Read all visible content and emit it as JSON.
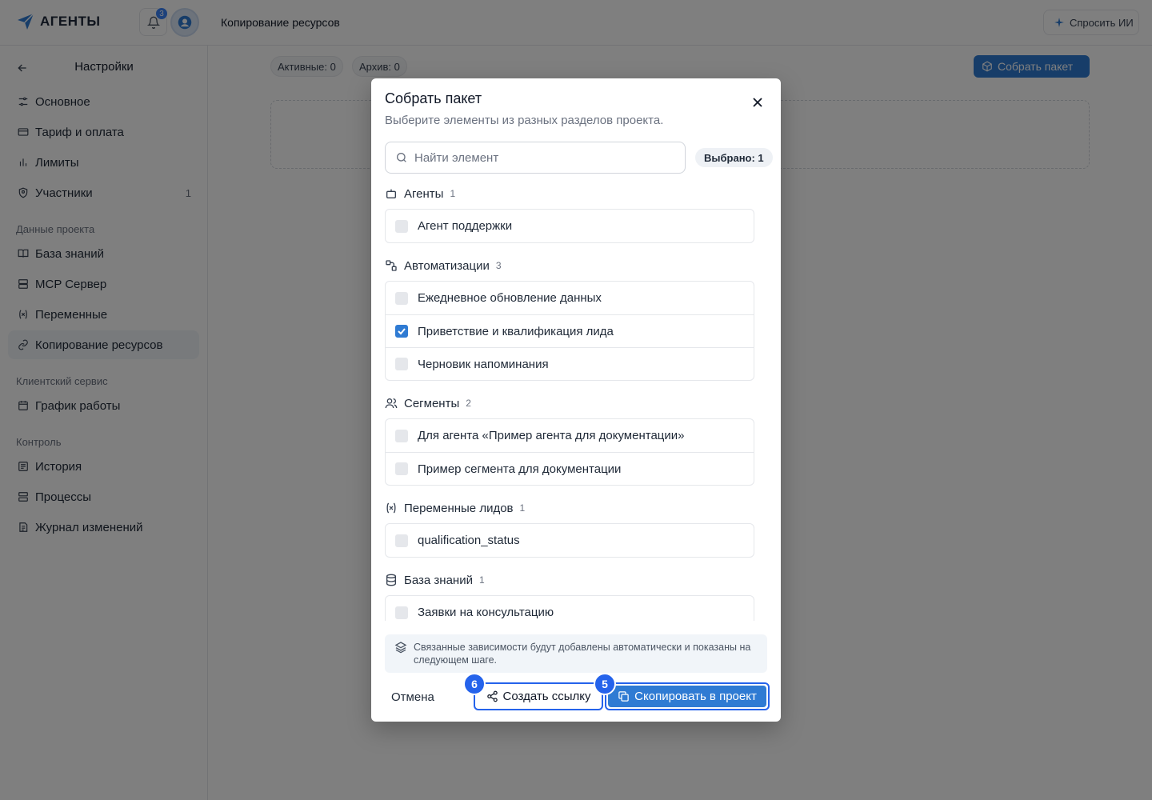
{
  "topbar": {
    "logo_text": "АГЕНТЫ",
    "notifications_count": "3",
    "page_title": "Копирование ресурсов",
    "ask_ai_label": "Спросить ИИ"
  },
  "sidebar": {
    "title": "Настройки",
    "items": [
      {
        "label": "Основное",
        "icon": "sliders-icon"
      },
      {
        "label": "Тариф и оплата",
        "icon": "card-icon"
      },
      {
        "label": "Лимиты",
        "icon": "bar-chart-icon"
      },
      {
        "label": "Участники",
        "icon": "shield-user-icon",
        "count": "1"
      }
    ],
    "sections": [
      {
        "title": "Данные проекта",
        "items": [
          {
            "label": "База знаний",
            "icon": "book-icon"
          },
          {
            "label": "MCP Сервер",
            "icon": "server-icon"
          },
          {
            "label": "Переменные",
            "icon": "variable-icon"
          },
          {
            "label": "Копирование ресурсов",
            "icon": "link-icon",
            "active": true
          }
        ]
      },
      {
        "title": "Клиентский сервис",
        "items": [
          {
            "label": "График работы",
            "icon": "calendar-icon"
          }
        ]
      },
      {
        "title": "Контроль",
        "items": [
          {
            "label": "История",
            "icon": "history-icon"
          },
          {
            "label": "Процессы",
            "icon": "list-icon"
          },
          {
            "label": "Журнал изменений",
            "icon": "changelog-icon"
          }
        ]
      }
    ]
  },
  "main": {
    "active_pill": "Активные: 0",
    "archive_pill": "Архив: 0",
    "collect_button": "Собрать пакет"
  },
  "modal": {
    "title": "Собрать пакет",
    "subtitle": "Выберите элементы из разных разделов проекта.",
    "search_placeholder": "Найти элемент",
    "selected_badge": "Выбрано: 1",
    "categories": [
      {
        "name": "Агенты",
        "count": "1",
        "icon": "bot-icon",
        "items": [
          {
            "label": "Агент поддержки",
            "checked": false
          }
        ]
      },
      {
        "name": "Автоматизации",
        "count": "3",
        "icon": "workflow-icon",
        "items": [
          {
            "label": "Ежедневное обновление данных",
            "checked": false
          },
          {
            "label": "Приветствие и квалификация лида",
            "checked": true
          },
          {
            "label": "Черновик напоминания",
            "checked": false
          }
        ]
      },
      {
        "name": "Сегменты",
        "count": "2",
        "icon": "users-icon",
        "items": [
          {
            "label": "Для агента «Пример агента для документации»",
            "checked": false
          },
          {
            "label": "Пример сегмента для документации",
            "checked": false
          }
        ]
      },
      {
        "name": "Переменные лидов",
        "count": "1",
        "icon": "variable-icon",
        "items": [
          {
            "label": "qualification_status",
            "checked": false
          }
        ]
      },
      {
        "name": "База знаний",
        "count": "1",
        "icon": "database-icon",
        "items": [
          {
            "label": "Заявки на консультацию",
            "checked": false
          }
        ]
      }
    ],
    "info_text": "Связанные зависимости будут добавлены автоматически и показаны на следующем шаге.",
    "cancel_label": "Отмена",
    "create_link_label": "Создать ссылку",
    "copy_label": "Скопировать в проект",
    "step_create_link": "6",
    "step_copy": "5"
  },
  "colors": {
    "accent": "#2f7bd3",
    "highlight": "#2563eb",
    "overlay": "rgba(0,0,0,0.5)"
  }
}
